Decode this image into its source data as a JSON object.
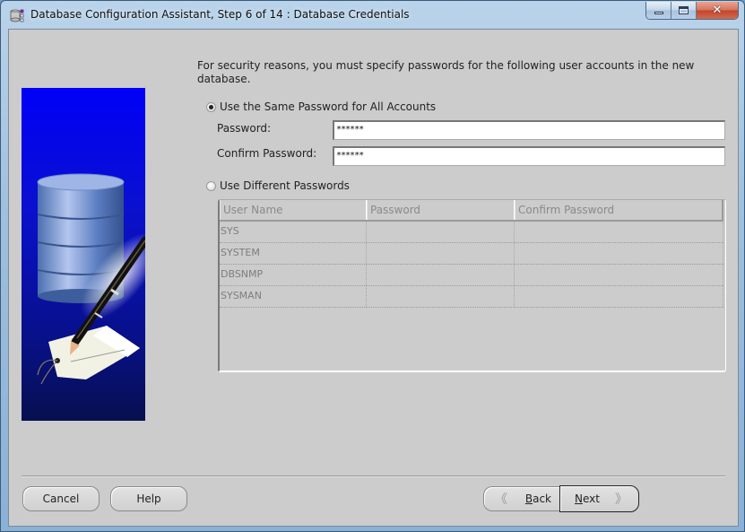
{
  "window": {
    "title": "Database Configuration Assistant, Step 6 of 14 : Database Credentials",
    "app_icon": "database-app-icon",
    "controls": {
      "minimize_icon": "minimize-icon",
      "maximize_icon": "maximize-icon",
      "close_glyph": "✕"
    }
  },
  "side_image": {
    "description": "database-cylinder-with-pen-and-tag",
    "colors": {
      "background_top": "#0000f8",
      "background_bottom": "#06104e",
      "cylinder": "#5b7fc0"
    }
  },
  "intro_text": "For security reasons, you must specify passwords for the following user accounts in the new database.",
  "options": {
    "same_password": {
      "label": "Use the Same Password for All Accounts",
      "selected": true,
      "password_label": "Password:",
      "password_value": "******",
      "confirm_label": "Confirm Password:",
      "confirm_value": "******"
    },
    "different_passwords": {
      "label": "Use Different Passwords",
      "selected": false
    }
  },
  "table": {
    "columns": [
      "User Name",
      "Password",
      "Confirm Password"
    ],
    "rows": [
      [
        "SYS",
        "",
        ""
      ],
      [
        "SYSTEM",
        "",
        ""
      ],
      [
        "DBSNMP",
        "",
        ""
      ],
      [
        "SYSMAN",
        "",
        ""
      ]
    ],
    "enabled": false
  },
  "buttons": {
    "cancel": "Cancel",
    "help": "Help",
    "back": {
      "mnemonic": "B",
      "rest": "ack",
      "chevron": "《"
    },
    "next": {
      "mnemonic": "N",
      "rest": "ext",
      "chevron": "》"
    }
  }
}
